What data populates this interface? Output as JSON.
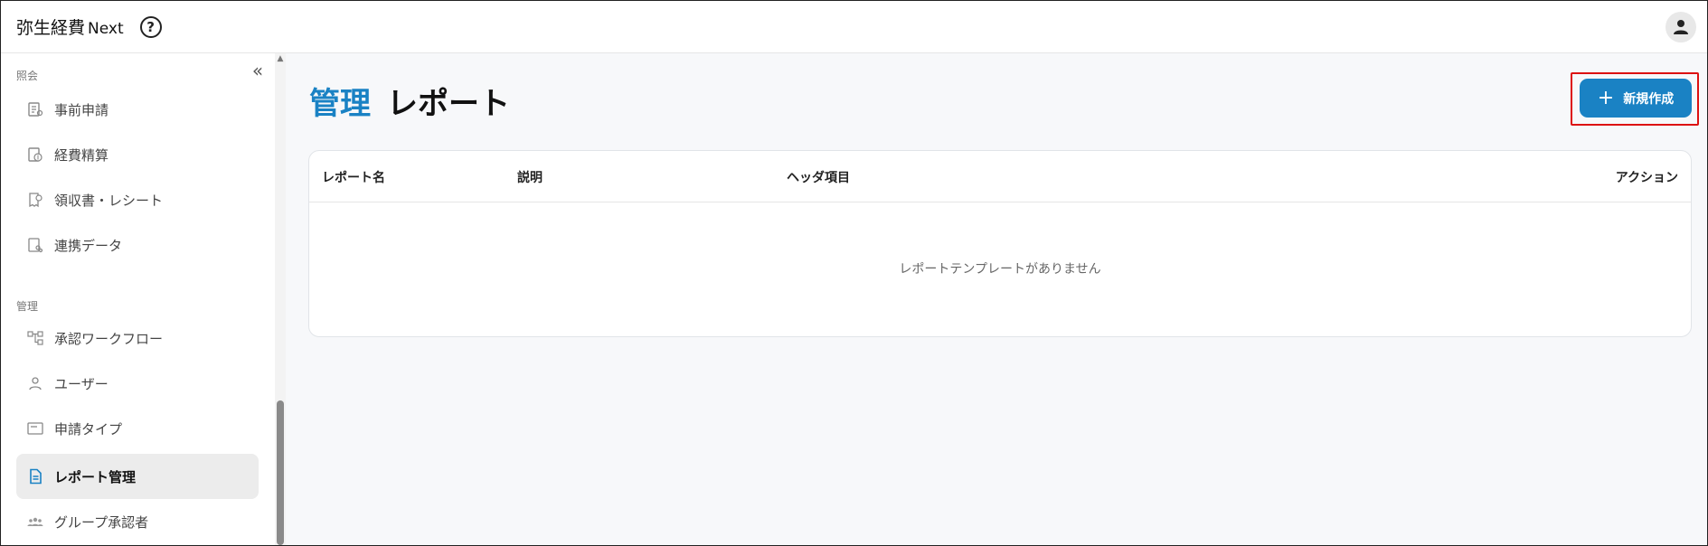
{
  "header": {
    "brand_main": "弥生経費",
    "brand_sub": "Next",
    "help_icon": "help-circle-icon",
    "avatar_icon": "person-icon"
  },
  "sidebar": {
    "sections": [
      {
        "label": "照会",
        "items": [
          {
            "label": "事前申請",
            "icon": "pre-application-icon"
          },
          {
            "label": "経費精算",
            "icon": "expense-settlement-icon"
          },
          {
            "label": "領収書・レシート",
            "icon": "receipt-icon"
          },
          {
            "label": "連携データ",
            "icon": "linked-data-icon"
          }
        ]
      },
      {
        "label": "管理",
        "items": [
          {
            "label": "承認ワークフロー",
            "icon": "workflow-icon"
          },
          {
            "label": "ユーザー",
            "icon": "user-icon"
          },
          {
            "label": "申請タイプ",
            "icon": "application-type-icon"
          },
          {
            "label": "レポート管理",
            "icon": "document-icon",
            "active": true
          },
          {
            "label": "グループ承認者",
            "icon": "group-icon"
          }
        ]
      }
    ]
  },
  "main": {
    "breadcrumb": "管理",
    "title": "レポート",
    "new_button_label": "新規作成",
    "table": {
      "columns": [
        "レポート名",
        "説明",
        "ヘッダ項目",
        "アクション"
      ],
      "empty_message": "レポートテンプレートがありません"
    }
  },
  "colors": {
    "accent": "#1a82c4",
    "highlight": "#dd1111",
    "active_bg": "#ececec"
  }
}
